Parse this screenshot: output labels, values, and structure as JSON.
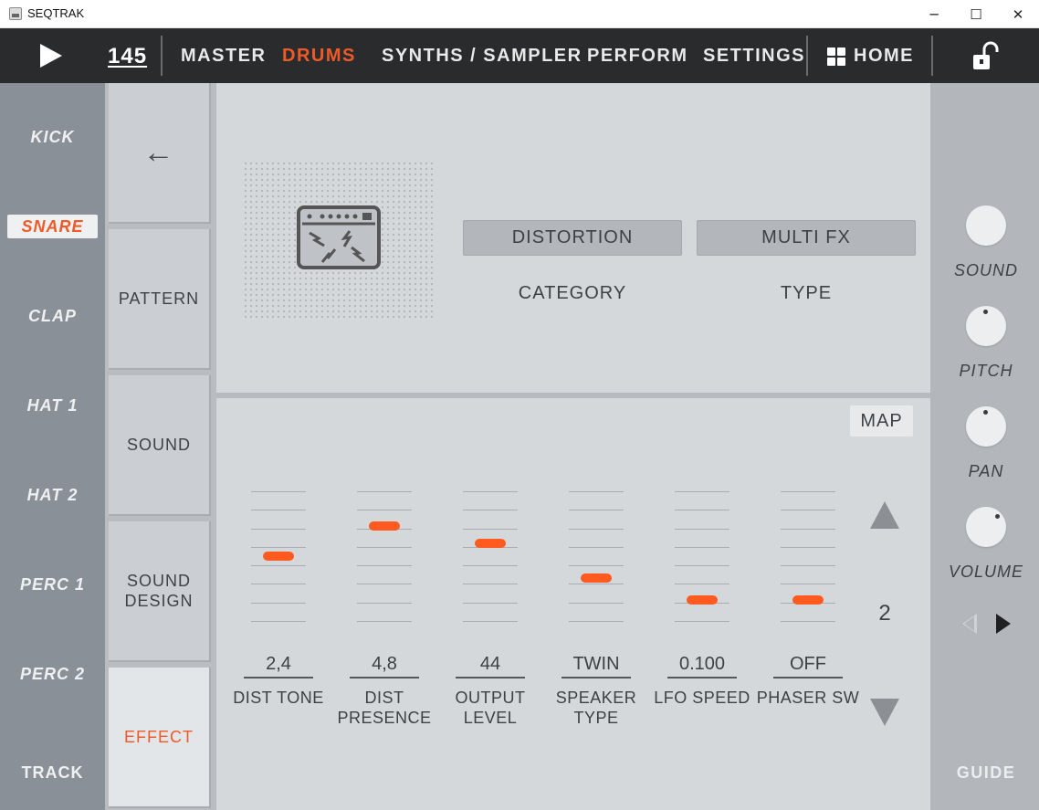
{
  "window": {
    "title": "SEQTRAK",
    "minimize_glyph": "─",
    "maximize_glyph": "☐",
    "close_glyph": "✕"
  },
  "toolbar": {
    "tempo": "145",
    "nav": [
      "MASTER",
      "DRUMS",
      "SYNTHS / SAMPLER",
      "PERFORM",
      "SETTINGS"
    ],
    "active_nav": "DRUMS",
    "home_label": "HOME"
  },
  "tracks": {
    "items": [
      "KICK",
      "SNARE",
      "CLAP",
      "HAT 1",
      "HAT 2",
      "PERC 1",
      "PERC 2"
    ],
    "selected": "SNARE",
    "footer": "TRACK"
  },
  "pages": {
    "back_glyph": "←",
    "items": [
      "PATTERN",
      "SOUND",
      "SOUND DESIGN",
      "EFFECT"
    ],
    "active": "EFFECT"
  },
  "effect": {
    "icon": "amp-distortion-icon",
    "category_value": "DISTORTION",
    "category_label": "CATEGORY",
    "type_value": "MULTI FX",
    "type_label": "TYPE"
  },
  "params": {
    "map_label": "MAP",
    "page_number": "2",
    "items": [
      {
        "value": "2,4",
        "label_line1": "DIST TONE",
        "label_line2": "",
        "level": 0.5
      },
      {
        "value": "4,8",
        "label_line1": "DIST",
        "label_line2": "PRESENCE",
        "level": 0.73
      },
      {
        "value": "44",
        "label_line1": "OUTPUT",
        "label_line2": "LEVEL",
        "level": 0.6
      },
      {
        "value": "TWIN",
        "label_line1": "SPEAKER",
        "label_line2": "TYPE",
        "level": 0.33
      },
      {
        "value": "0.100",
        "label_line1": "LFO SPEED",
        "label_line2": "",
        "level": 0.16
      },
      {
        "value": "OFF",
        "label_line1": "PHASER SW",
        "label_line2": "",
        "level": 0.16
      }
    ]
  },
  "right": {
    "knobs": [
      "SOUND",
      "PITCH",
      "PAN",
      "VOLUME"
    ],
    "guide": "GUIDE"
  },
  "colors": {
    "accent": "#ef5a28",
    "slider_thumb": "#ff5a1f",
    "toolbar_bg": "#2a2b2d"
  }
}
